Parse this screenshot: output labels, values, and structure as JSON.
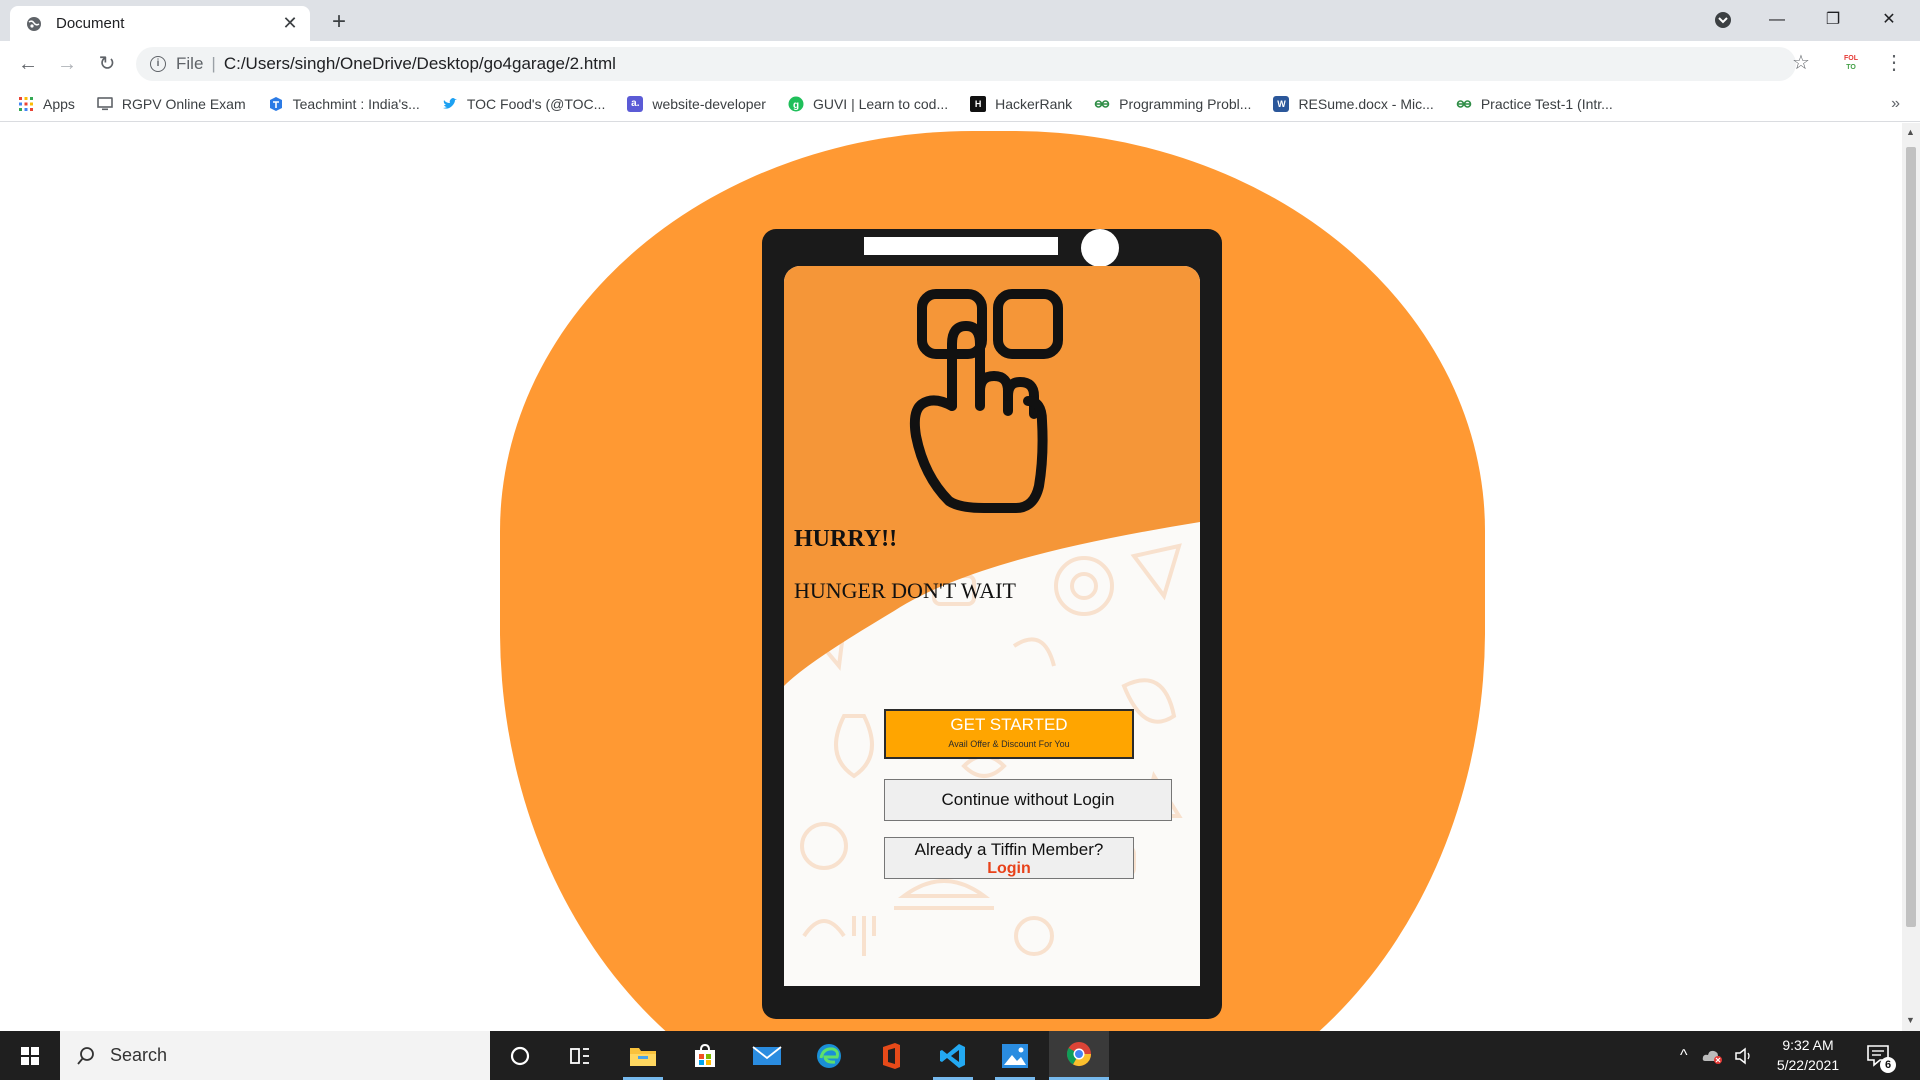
{
  "browser": {
    "tab_title": "Document",
    "omnibox_scheme": "File",
    "url": "C:/Users/singh/OneDrive/Desktop/go4garage/2.html",
    "ext_text": "FOL\nTO",
    "bookmarks": [
      {
        "label": "Apps",
        "icon": "apps-grid-icon",
        "color": "#ea4335"
      },
      {
        "label": "RGPV Online Exam",
        "icon": "monitor-icon",
        "color": "#5f6368"
      },
      {
        "label": "Teachmint : India's...",
        "icon": "teachmint-icon",
        "color": "#2c7be5"
      },
      {
        "label": "TOC Food's (@TOC...",
        "icon": "twitter-icon",
        "color": "#1da1f2"
      },
      {
        "label": "website-developer",
        "icon": "a-icon",
        "color": "#5b5bd6"
      },
      {
        "label": "GUVI | Learn to cod...",
        "icon": "guvi-icon",
        "color": "#1fbf5a"
      },
      {
        "label": "HackerRank",
        "icon": "hackerrank-icon",
        "color": "#111111"
      },
      {
        "label": "Programming Probl...",
        "icon": "gfg-icon",
        "color": "#2f8d46"
      },
      {
        "label": "RESume.docx - Mic...",
        "icon": "word-icon",
        "color": "#2b579a"
      },
      {
        "label": "Practice Test-1 (Intr...",
        "icon": "gfg-icon",
        "color": "#2f8d46"
      }
    ],
    "more_bookmarks": "»"
  },
  "page": {
    "headline": "HURRY!!",
    "subheadline": "HUNGER DON'T WAIT",
    "get_started": "GET STARTED",
    "get_started_sub": "Avail Offer & Discount For You",
    "continue_label": "Continue without Login",
    "member_question": "Already a Tiffin Member?",
    "login_label": "Login",
    "colors": {
      "orange": "#ff9933",
      "button_orange": "#ffa500",
      "login_red": "#e8421a"
    }
  },
  "taskbar": {
    "search_label": "Search",
    "time": "9:32 AM",
    "date": "5/22/2021",
    "notification_count": "6",
    "apps": [
      "cortana-icon",
      "task-view-icon",
      "file-explorer-icon",
      "store-icon",
      "mail-icon",
      "edge-icon",
      "office-icon",
      "vscode-icon",
      "photos-icon",
      "chrome-icon"
    ]
  }
}
